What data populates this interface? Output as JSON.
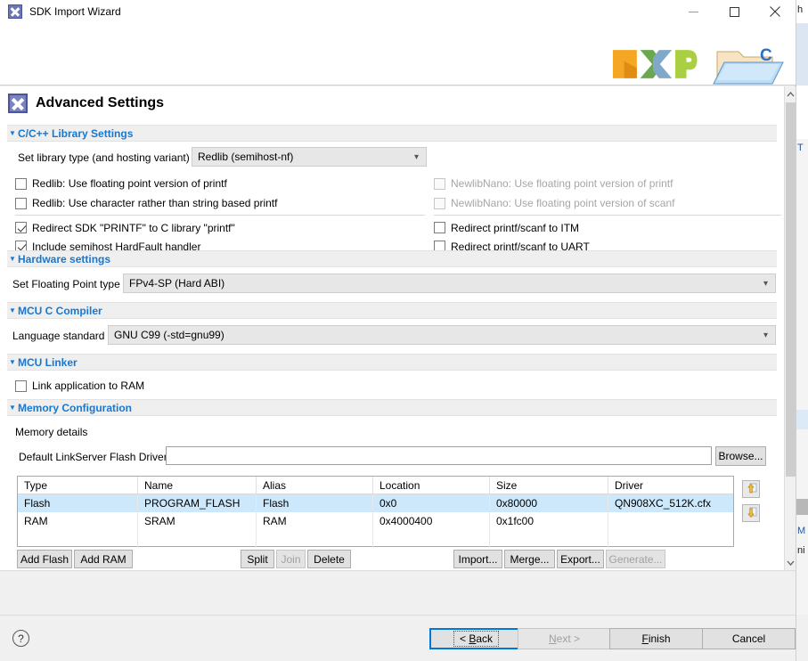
{
  "window": {
    "title": "SDK Import Wizard",
    "app_icon": "x-logo-icon",
    "minimize": "minimize-icon",
    "maximize": "maximize-icon",
    "close": "close-icon"
  },
  "banner": {
    "logo": "nxp-logo",
    "project_icon": "c-project-folder-icon"
  },
  "page": {
    "icon": "x-logo-icon",
    "title": "Advanced Settings"
  },
  "sections": {
    "library": {
      "title": "C/C++ Library Settings",
      "expander": "triangle-down-icon",
      "library_type_label": "Set library type (and hosting variant)",
      "library_type_value": "Redlib (semihost-nf)",
      "checkboxes_left": [
        {
          "label": "Redlib: Use floating point version of printf",
          "checked": false,
          "enabled": true
        },
        {
          "label": "Redlib: Use character rather than string based printf",
          "checked": false,
          "enabled": true
        },
        {
          "label": "Redirect SDK \"PRINTF\" to C library \"printf\"",
          "checked": true,
          "enabled": true
        },
        {
          "label": "Include semihost HardFault handler",
          "checked": true,
          "enabled": true
        }
      ],
      "checkboxes_right": [
        {
          "label": "NewlibNano: Use floating point version of printf",
          "checked": false,
          "enabled": false
        },
        {
          "label": "NewlibNano: Use floating point version of scanf",
          "checked": false,
          "enabled": false
        },
        {
          "label": "Redirect printf/scanf to ITM",
          "checked": false,
          "enabled": true
        },
        {
          "label": "Redirect printf/scanf to UART",
          "checked": false,
          "enabled": true
        }
      ]
    },
    "hardware": {
      "title": "Hardware settings",
      "expander": "triangle-down-icon",
      "fp_label": "Set Floating Point type",
      "fp_value": "FPv4-SP (Hard ABI)"
    },
    "compiler": {
      "title": "MCU C Compiler",
      "expander": "triangle-down-icon",
      "lang_label": "Language standard",
      "lang_value": "GNU C99 (-std=gnu99)"
    },
    "linker": {
      "title": "MCU Linker",
      "expander": "triangle-down-icon",
      "link_ram_label": "Link application to RAM",
      "link_ram_checked": false
    },
    "memory": {
      "title": "Memory Configuration",
      "expander": "triangle-down-icon",
      "details_label": "Memory details",
      "driver_label": "Default LinkServer Flash Driver",
      "driver_value": "",
      "browse_label": "Browse...",
      "move_up_icon": "move-up-icon",
      "move_down_icon": "move-down-icon",
      "columns": [
        "Type",
        "Name",
        "Alias",
        "Location",
        "Size",
        "Driver"
      ],
      "rows": [
        {
          "cells": [
            "Flash",
            "PROGRAM_FLASH",
            "Flash",
            "0x0",
            "0x80000",
            "QN908XC_512K.cfx"
          ],
          "selected": true
        },
        {
          "cells": [
            "RAM",
            "SRAM",
            "RAM",
            "0x4000400",
            "0x1fc00",
            ""
          ],
          "selected": false
        }
      ],
      "toolbar": [
        {
          "label": "Add Flash",
          "enabled": true
        },
        {
          "label": "Add RAM",
          "enabled": true
        },
        {
          "label": "Split",
          "enabled": true
        },
        {
          "label": "Join",
          "enabled": false
        },
        {
          "label": "Delete",
          "enabled": true
        },
        {
          "label": "Import...",
          "enabled": true
        },
        {
          "label": "Merge...",
          "enabled": true
        },
        {
          "label": "Export...",
          "enabled": true
        },
        {
          "label": "Generate...",
          "enabled": false
        }
      ]
    }
  },
  "buttons": {
    "help": "?",
    "back": {
      "prefix": "< ",
      "mnemonic": "B",
      "suffix": "ack",
      "enabled": true,
      "focused": true
    },
    "next": {
      "prefix": "",
      "mnemonic": "N",
      "suffix": "ext >",
      "enabled": false,
      "focused": false
    },
    "finish": {
      "prefix": "",
      "mnemonic": "F",
      "suffix": "inish",
      "enabled": true,
      "focused": false
    },
    "cancel": {
      "prefix": "",
      "mnemonic": "",
      "suffix": "Cancel",
      "enabled": true,
      "focused": false
    }
  },
  "scrollbar": {
    "up": "chevron-up-icon",
    "down": "chevron-down-icon"
  },
  "background_window": {
    "fragments": [
      "h",
      "T",
      "M",
      "ni"
    ]
  },
  "colors": {
    "section_header_text": "#1878d0",
    "selection": "#cde8fb",
    "focus_border": "#0078d7"
  }
}
